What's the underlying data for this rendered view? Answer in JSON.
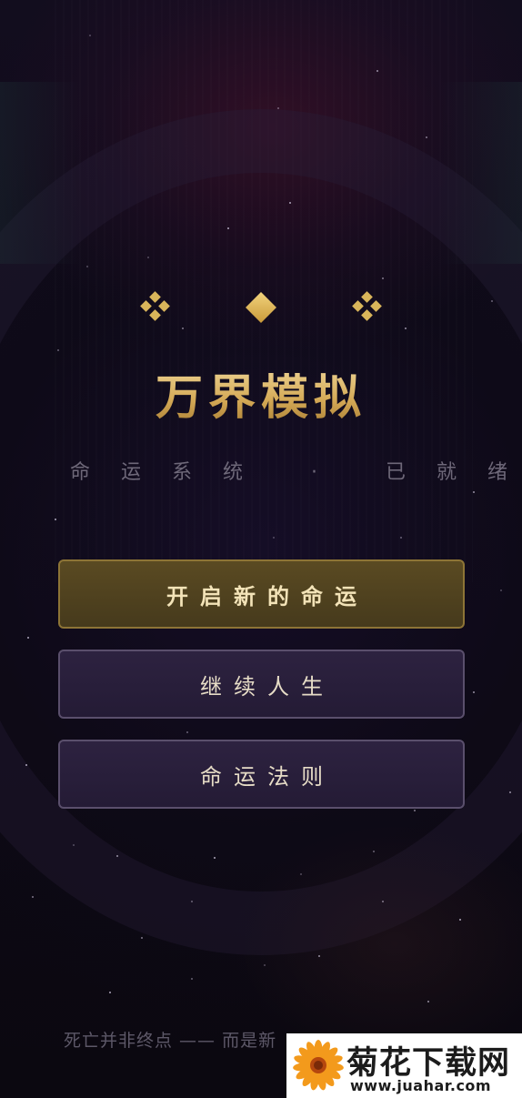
{
  "app": {
    "title": "万界模拟",
    "subtitle": "命运系统 · 已就绪"
  },
  "ornaments": [
    "diamond-cluster-icon",
    "diamond-icon",
    "diamond-cluster-icon"
  ],
  "menu": {
    "start_label": "开启新的命运",
    "continue_label": "继续人生",
    "rules_label": "命运法则"
  },
  "footer": {
    "quote": "死亡并非终点 —— 而是新"
  },
  "watermark": {
    "site_name": "菊花下载网",
    "url": "www.juahar.com"
  },
  "colors": {
    "gold": "#e2c07a",
    "primary_button_bg": "#4f4120",
    "primary_button_border": "#8d7436",
    "secondary_button_bg": "#2a2040",
    "secondary_button_border": "#5a4f6c",
    "background": "#0c0912"
  }
}
